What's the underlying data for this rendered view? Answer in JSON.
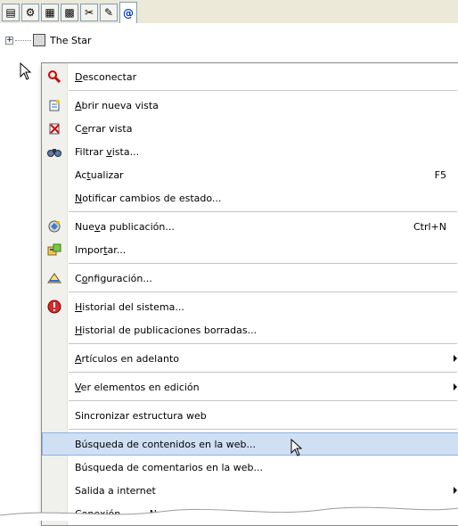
{
  "toolbar": {
    "tabs": [
      {
        "icon": "newspaper-icon",
        "glyph": "▤"
      },
      {
        "icon": "gear-icon",
        "glyph": "⚙"
      },
      {
        "icon": "grid-icon",
        "glyph": "▦"
      },
      {
        "icon": "palette-icon",
        "glyph": "▩"
      },
      {
        "icon": "tools-icon",
        "glyph": "✂"
      },
      {
        "icon": "wrench-icon",
        "glyph": "✎"
      },
      {
        "icon": "at-icon",
        "glyph": "@"
      }
    ],
    "active_index": 6
  },
  "tree": {
    "root_label": "The Star"
  },
  "menu": {
    "items": [
      {
        "name": "menu-item-desconectar",
        "icon": "magnifier-disconnect-icon",
        "pre": "",
        "u": "D",
        "post": "esconectar",
        "shortcut": "",
        "submenu": false
      },
      {
        "name": "menu-item-abrir-nueva-vista",
        "icon": "new-view-icon",
        "pre": "",
        "u": "A",
        "post": "brir nueva vista",
        "shortcut": "",
        "submenu": false
      },
      {
        "name": "menu-item-cerrar-vista",
        "icon": "close-view-icon",
        "pre": "C",
        "u": "e",
        "post": "rrar vista",
        "shortcut": "",
        "submenu": false
      },
      {
        "name": "menu-item-filtrar-vista",
        "icon": "binoculars-icon",
        "pre": "Filtrar ",
        "u": "v",
        "post": "ista...",
        "shortcut": "",
        "submenu": false
      },
      {
        "name": "menu-item-actualizar",
        "icon": "",
        "pre": "Ac",
        "u": "t",
        "post": "ualizar",
        "shortcut": "F5",
        "submenu": false
      },
      {
        "name": "menu-item-notificar-cambios",
        "icon": "",
        "pre": "",
        "u": "N",
        "post": "otificar cambios de estado...",
        "shortcut": "",
        "submenu": false
      },
      {
        "name": "menu-item-nueva-publicacion",
        "icon": "new-publication-icon",
        "pre": "Nue",
        "u": "v",
        "post": "a publicación...",
        "shortcut": "Ctrl+N",
        "submenu": false
      },
      {
        "name": "menu-item-importar",
        "icon": "import-icon",
        "pre": "Impor",
        "u": "t",
        "post": "ar...",
        "shortcut": "",
        "submenu": false
      },
      {
        "name": "menu-item-configuracion",
        "icon": "settings-icon",
        "pre": "C",
        "u": "o",
        "post": "nfiguración...",
        "shortcut": "",
        "submenu": false
      },
      {
        "name": "menu-item-historial-sistema",
        "icon": "history-icon",
        "pre": "",
        "u": "H",
        "post": "istorial del sistema...",
        "shortcut": "",
        "submenu": false
      },
      {
        "name": "menu-item-historial-borradas",
        "icon": "",
        "pre": "",
        "u": "H",
        "post": "istorial de publicaciones borradas...",
        "shortcut": "",
        "submenu": false
      },
      {
        "name": "menu-item-articulos-adelanto",
        "icon": "",
        "pre": "",
        "u": "A",
        "post": "rtículos en adelanto",
        "shortcut": "",
        "submenu": true
      },
      {
        "name": "menu-item-ver-elementos",
        "icon": "",
        "pre": "",
        "u": "V",
        "post": "er elementos en edición",
        "shortcut": "",
        "submenu": true
      },
      {
        "name": "menu-item-sincronizar",
        "icon": "",
        "pre": "Sincronizar estructura web",
        "u": "",
        "post": "",
        "shortcut": "",
        "submenu": false
      },
      {
        "name": "menu-item-busqueda-contenidos",
        "icon": "",
        "pre": "Búsqueda de contenidos en la web...",
        "u": "",
        "post": "",
        "shortcut": "",
        "submenu": false
      },
      {
        "name": "menu-item-busqueda-comentarios",
        "icon": "",
        "pre": "Búsqueda de comentarios en la web...",
        "u": "",
        "post": "",
        "shortcut": "",
        "submenu": false
      },
      {
        "name": "menu-item-salida-internet",
        "icon": "",
        "pre": "Salida a internet",
        "u": "",
        "post": "",
        "shortcut": "",
        "submenu": true
      },
      {
        "name": "menu-item-partial",
        "icon": "",
        "pre": "Conexión … … Nexus",
        "u": "",
        "post": "",
        "shortcut": "",
        "submenu": false
      }
    ],
    "highlighted_index": 14
  },
  "colors": {
    "highlight": "#cfe0f5",
    "highlight_border": "#8db2e3",
    "gutter": "#f0f0ec"
  }
}
